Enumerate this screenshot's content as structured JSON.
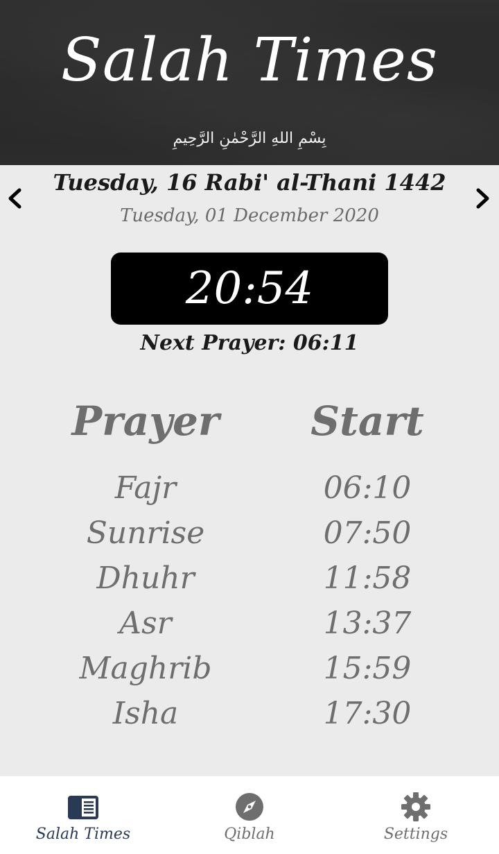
{
  "header": {
    "app_title": "Salah Times",
    "bismillah": "بِسْمِ اللهِ الرَّحْمٰنِ الرَّحِيمِ"
  },
  "date": {
    "hijri": "Tuesday, 16 Rabi' al-Thani 1442",
    "gregorian": "Tuesday, 01 December 2020",
    "prev_icon": "chevron-left-icon",
    "next_icon": "chevron-right-icon"
  },
  "clock": {
    "time": "20:54",
    "next_prayer": "Next Prayer: 06:11"
  },
  "table": {
    "header_prayer": "Prayer",
    "header_start": "Start",
    "rows": [
      {
        "name": "Fajr",
        "time": "06:10"
      },
      {
        "name": "Sunrise",
        "time": "07:50"
      },
      {
        "name": "Dhuhr",
        "time": "11:58"
      },
      {
        "name": "Asr",
        "time": "13:37"
      },
      {
        "name": "Maghrib",
        "time": "15:59"
      },
      {
        "name": "Isha",
        "time": "17:30"
      }
    ]
  },
  "bottom_nav": {
    "tabs": [
      {
        "label": "Salah Times",
        "icon": "book-list-icon",
        "active": true
      },
      {
        "label": "Qiblah",
        "icon": "compass-icon",
        "active": false
      },
      {
        "label": "Settings",
        "icon": "gear-icon",
        "active": false
      }
    ]
  },
  "colors": {
    "header_bg": "#2a2a2a",
    "page_bg": "#ebebeb",
    "clock_bg": "#000000",
    "active_tab": "#2a3a55",
    "inactive": "#6e6e6e"
  }
}
